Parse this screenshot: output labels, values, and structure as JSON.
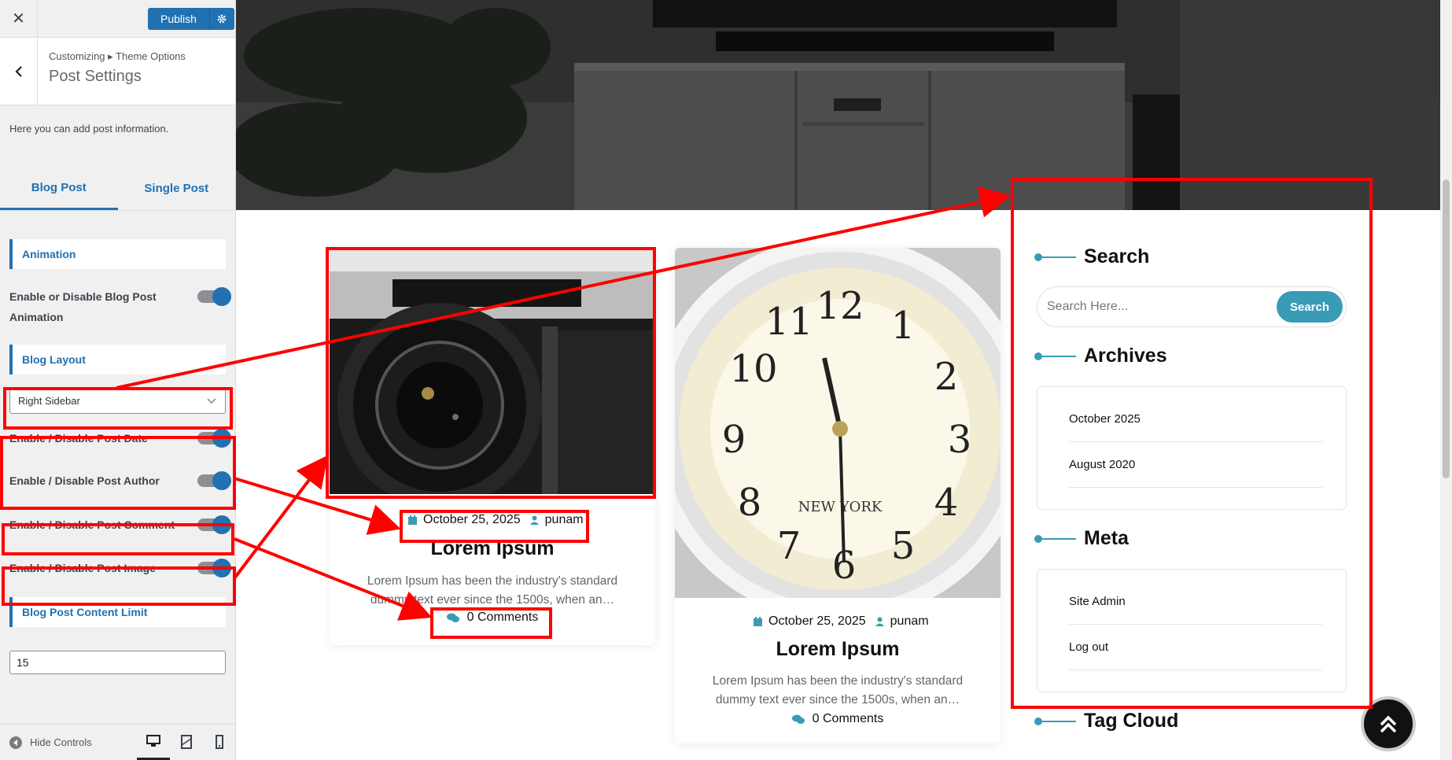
{
  "customizer": {
    "close_glyph": "✕",
    "publish_label": "Publish",
    "back_glyph": "‹",
    "breadcrumb": "Customizing ▸ Theme Options",
    "section_title": "Post Settings",
    "description": "Here you can add post information.",
    "tabs": [
      {
        "label": "Blog Post",
        "active": true
      },
      {
        "label": "Single Post",
        "active": false
      }
    ],
    "animation_heading": "Animation",
    "animation_toggle": "Enable or Disable Blog Post Animation",
    "layout_heading": "Blog Layout",
    "layout_value": "Right Sidebar",
    "toggles": [
      "Enable / Disable Post Date",
      "Enable / Disable Post Author",
      "Enable / Disable Post Comment",
      "Enable / Disable Post Image"
    ],
    "content_limit_heading": "Blog Post Content Limit",
    "content_limit_value": "15",
    "hide_controls": "Hide Controls",
    "accent_color": "#2271b1"
  },
  "posts": [
    {
      "date": "October 25, 2025",
      "author": "punam",
      "title": "Lorem Ipsum",
      "excerpt": "Lorem Ipsum has been the industry's standard dummy text ever since the 1500s, when an…",
      "comments": "0 Comments",
      "image": "camera"
    },
    {
      "date": "October 25, 2025",
      "author": "punam",
      "title": "Lorem Ipsum",
      "excerpt": "Lorem Ipsum has been the industry's standard dummy text ever since the 1500s, when an…",
      "comments": "0 Comments",
      "image": "clock"
    }
  ],
  "sidebar_widgets": {
    "search_title": "Search",
    "search_placeholder": "Search Here...",
    "search_button": "Search",
    "archives_title": "Archives",
    "archives": [
      "October 2025",
      "August 2020"
    ],
    "meta_title": "Meta",
    "meta_links": [
      "Site Admin",
      "Log out"
    ],
    "tagcloud_title": "Tag Cloud",
    "accent_color": "#3a9bb5"
  },
  "annotation_color": "#ff0000"
}
